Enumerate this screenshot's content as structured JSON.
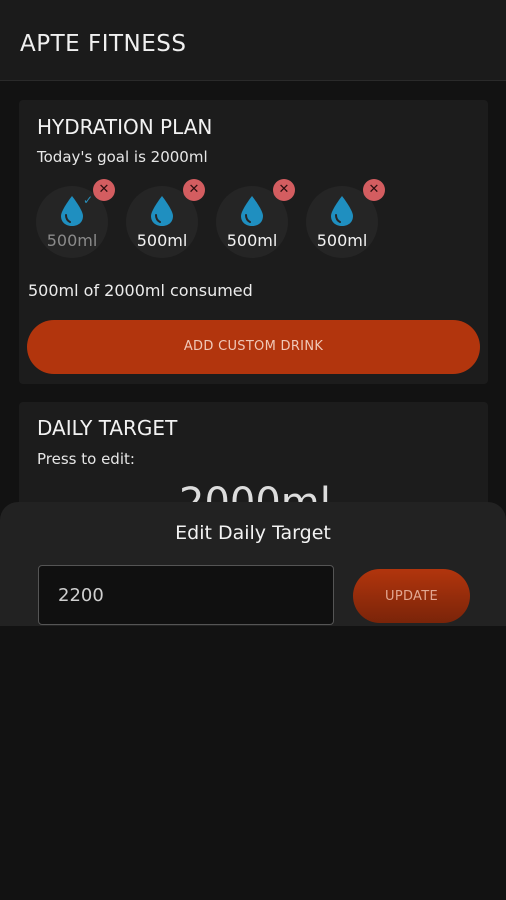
{
  "app": {
    "title": "APTE FITNESS"
  },
  "hydration": {
    "title": "HYDRATION PLAN",
    "goal_text": "Today's goal is 2000ml",
    "drinks": [
      {
        "amount": "500ml",
        "consumed": true
      },
      {
        "amount": "500ml",
        "consumed": false
      },
      {
        "amount": "500ml",
        "consumed": false
      },
      {
        "amount": "500ml",
        "consumed": false
      }
    ],
    "consumed_text": "500ml of 2000ml consumed",
    "add_button_label": "ADD CUSTOM DRINK"
  },
  "daily_target": {
    "title": "DAILY TARGET",
    "subtitle": "Press to edit:",
    "value": "2000ml"
  },
  "edit_sheet": {
    "title": "Edit Daily Target",
    "input_value": "2200",
    "update_label": "UPDATE"
  },
  "colors": {
    "accent": "#b2350d",
    "drop": "#1f8fc0",
    "remove_badge": "#d35d60"
  },
  "icons": {
    "drop": "water-drop-icon",
    "remove": "close-icon",
    "check": "check-icon"
  }
}
